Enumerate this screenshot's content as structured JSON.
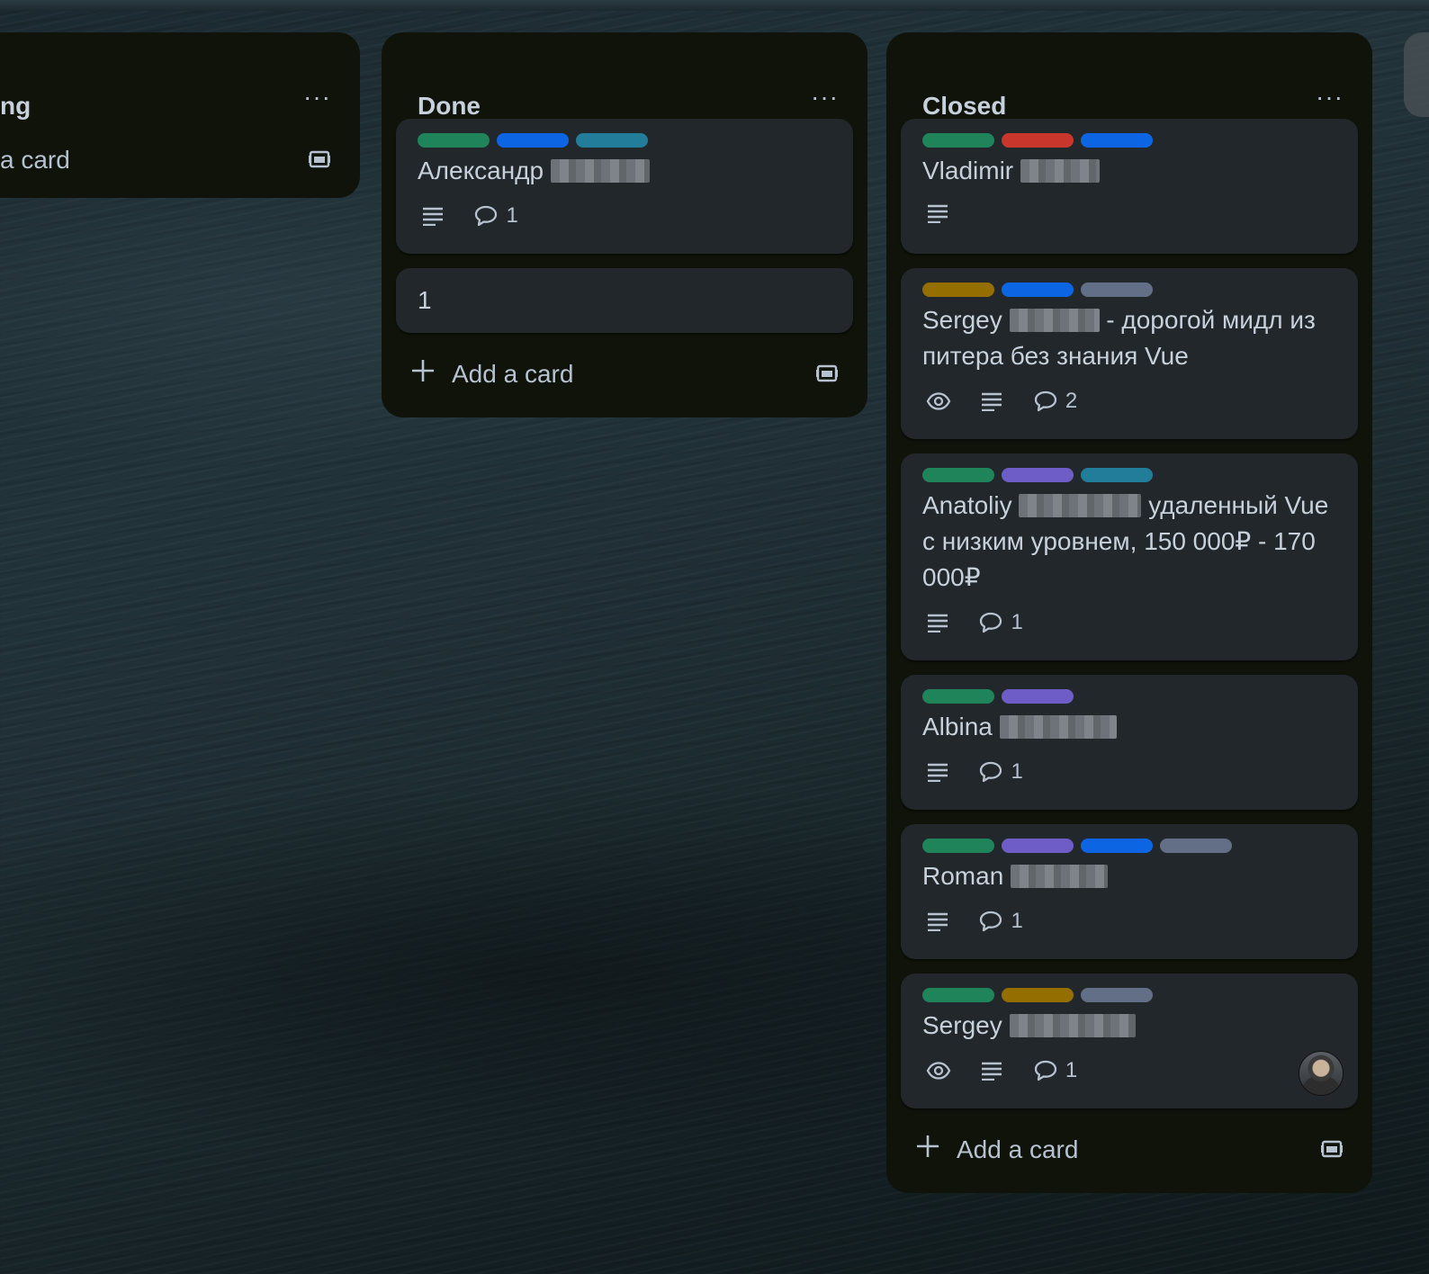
{
  "colors": {
    "list_bg": "#0f130a",
    "card_bg": "#22272b",
    "green": "#1f845a",
    "blue": "#0c66e4",
    "teal": "#227d9b",
    "red": "#c9372c",
    "yellow": "#946f00",
    "gray": "#626f86",
    "purple": "#6e5dc6"
  },
  "lists": [
    {
      "title": "ng",
      "menu": "···",
      "add_label": "a card"
    },
    {
      "title": "Done",
      "menu": "···",
      "add_label": "Add a card",
      "cards": [
        {
          "labels": [
            "green",
            "blue",
            "teal"
          ],
          "title": "Александр",
          "comments": "1"
        },
        {
          "title": "1"
        }
      ]
    },
    {
      "title": "Closed",
      "menu": "···",
      "add_label": "Add a card",
      "cards": [
        {
          "labels": [
            "green",
            "red",
            "blue"
          ],
          "title": "Vladimir"
        },
        {
          "labels": [
            "yellow",
            "blue",
            "gray"
          ],
          "title": "Sergey",
          "title_rest": "- дорогой мидл из питера без знания Vue",
          "comments": "2"
        },
        {
          "labels": [
            "green",
            "purple",
            "teal"
          ],
          "title": "Anatoliy",
          "title_rest": "удаленный Vue с низким уровнем, 150 000₽ - 170 000₽",
          "comments": "1"
        },
        {
          "labels": [
            "green",
            "purple"
          ],
          "title": "Albina",
          "comments": "1"
        },
        {
          "labels": [
            "green",
            "purple",
            "blue",
            "gray"
          ],
          "title": "Roman",
          "comments": "1"
        },
        {
          "labels": [
            "green",
            "yellow",
            "gray"
          ],
          "title": "Sergey",
          "comments": "1"
        }
      ]
    }
  ]
}
